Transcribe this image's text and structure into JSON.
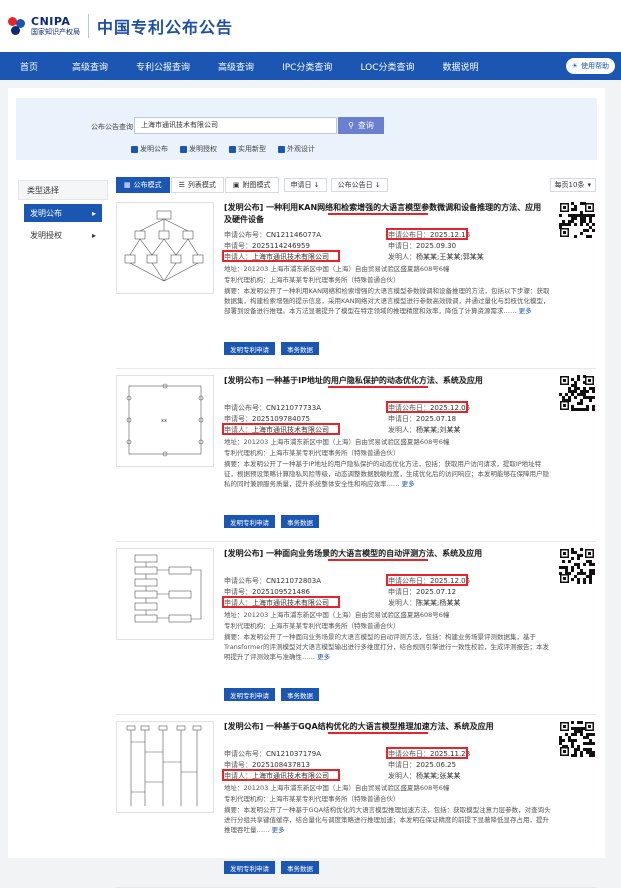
{
  "header": {
    "logo_en": "CNIPA",
    "logo_cn": "国家知识产权局",
    "site_title": "中国专利公布公告"
  },
  "nav": {
    "items": [
      "首页",
      "高级查询",
      "专利公报查询",
      "高级查询",
      "IPC分类查询",
      "LOC分类查询",
      "数据说明"
    ],
    "help": "使用帮助"
  },
  "search": {
    "label": "公布公告查询",
    "value": "上海市通讯技术有限公司",
    "button": "查询",
    "checks": [
      "发明公布",
      "发明授权",
      "实用新型",
      "外观设计"
    ]
  },
  "sidebar": {
    "head": "类型选择",
    "items": [
      {
        "label": "发明公布",
        "arrow": "▸"
      },
      {
        "label": "发明授权",
        "arrow": "▸"
      }
    ]
  },
  "toolbar": {
    "tabs": [
      "公布模式",
      "列表模式",
      "附图模式"
    ],
    "sort1": "申请日 ↓",
    "sort2": "公布公告日 ↓",
    "per_page": "每页10条"
  },
  "results": [
    {
      "title": "[发明公布] 一种利用KAN网络和检索增强的大语言模型参数微调和设备推理的方法、应用及硬件设备",
      "pub_no_label": "申请公布号：",
      "pub_no": "CN121146077A",
      "pub_date_label": "申请公布日：",
      "pub_date": "2025.12.16",
      "app_no_label": "申请号：",
      "app_no": "2025114246959",
      "app_date_label": "申请日：",
      "app_date": "2025.09.30",
      "applicant_label": "申请人：",
      "applicant": "上海市通讯技术有限公司",
      "inventor_label": "发明人：",
      "inventor": "杨某某;王某某;郭某某",
      "address": "地址：201203 上海市浦东新区中国（上海）自由贸易试验区盛夏路608号6幢",
      "agency": "专利代理机构：上海市某某专利代理事务所（特殊普通合伙）",
      "abstract": "摘要：本发明公开了一种利用KAN网络和检索增强的大语言模型参数微调和设备推理的方法，包括以下步骤：获取数据集，构建检索增强的提示信息，采用KAN网络对大语言模型进行参数高效微调，并通过量化与剪枝优化模型，部署到设备进行推理。本方法显著提升了模型在特定领域的推理精度和效率，降低了计算资源需求……",
      "more": "更多",
      "btn1": "发明专利申请",
      "btn2": "事务数据"
    },
    {
      "title": "[发明公布] 一种基于IP地址的用户隐私保护的动态优化方法、系统及应用",
      "pub_no_label": "申请公布号：",
      "pub_no": "CN121077733A",
      "pub_date_label": "申请公布日：",
      "pub_date": "2025.12.05",
      "app_no_label": "申请号：",
      "app_no": "2025109784075",
      "app_date_label": "申请日：",
      "app_date": "2025.07.18",
      "applicant_label": "申请人：",
      "applicant": "上海市通讯技术有限公司",
      "inventor_label": "发明人：",
      "inventor": "杨某某;刘某某",
      "address": "地址：201203 上海市浦东新区中国（上海）自由贸易试验区盛夏路608号6幢",
      "agency": "专利代理机构：上海市某某专利代理事务所（特殊普通合伙）",
      "abstract": "摘要：本发明公开了一种基于IP地址的用户隐私保护的动态优化方法，包括：获取用户访问请求，提取IP地址特征，根据预设策略计算隐私风险等级，动态调整数据脱敏粒度，生成优化后的访问响应；本发明能够在保障用户隐私的同时兼顾服务质量，提升系统整体安全性和响应效率……",
      "more": "更多",
      "btn1": "发明专利申请",
      "btn2": "事务数据"
    },
    {
      "title": "[发明公布] 一种面向业务场景的大语言模型的自动评测方法、系统及应用",
      "pub_no_label": "申请公布号：",
      "pub_no": "CN121072803A",
      "pub_date_label": "申请公布日：",
      "pub_date": "2025.12.05",
      "app_no_label": "申请号：",
      "app_no": "2025109521486",
      "app_date_label": "申请日：",
      "app_date": "2025.07.12",
      "applicant_label": "申请人：",
      "applicant": "上海市通讯技术有限公司",
      "inventor_label": "发明人：",
      "inventor": "陈某某;杨某某",
      "address": "地址：201203 上海市浦东新区中国（上海）自由贸易试验区盛夏路608号6幢",
      "agency": "专利代理机构：上海市某某专利代理事务所（特殊普通合伙）",
      "abstract": "摘要：本发明公开了一种面向业务场景的大语言模型的自动评测方法，包括：构建业务场景评测数据集，基于Transformer的评测模型对大语言模型输出进行多维度打分，结合规则引擎进行一致性校验，生成评测报告；本发明提升了评测效率与准确性……",
      "more": "更多",
      "btn1": "发明专利申请",
      "btn2": "事务数据"
    },
    {
      "title": "[发明公布] 一种基于GQA结构优化的大语言模型推理加速方法、系统及应用",
      "pub_no_label": "申请公布号：",
      "pub_no": "CN121037179A",
      "pub_date_label": "申请公布日：",
      "pub_date": "2025.11.28",
      "app_no_label": "申请号：",
      "app_no": "2025108437813",
      "app_date_label": "申请日：",
      "app_date": "2025.06.25",
      "applicant_label": "申请人：",
      "applicant": "上海市通讯技术有限公司",
      "inventor_label": "发明人：",
      "inventor": "杨某某;张某某",
      "address": "地址：201203 上海市浦东新区中国（上海）自由贸易试验区盛夏路608号6幢",
      "agency": "专利代理机构：上海市某某专利代理事务所（特殊普通合伙）",
      "abstract": "摘要：本发明公开了一种基于GQA结构优化的大语言模型推理加速方法，包括：获取模型注意力层参数，对查询头进行分组共享键值缓存，结合量化与调度策略进行推理加速；本发明在保证精度的前提下显著降低显存占用，提升推理吞吐量……",
      "more": "更多",
      "btn1": "发明专利申请",
      "btn2": "事务数据"
    }
  ],
  "colors": {
    "nav_blue": "#1b56b3",
    "highlight_red": "#e8232a"
  }
}
